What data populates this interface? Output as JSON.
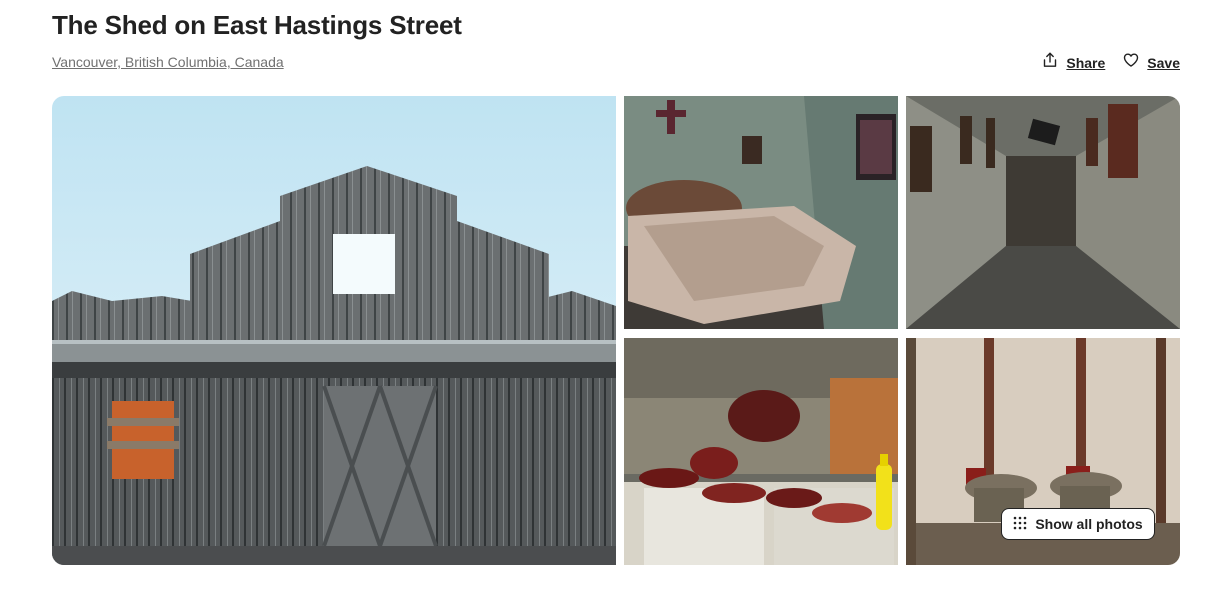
{
  "listing": {
    "title": "The Shed on East Hastings Street",
    "location": "Vancouver, British Columbia, Canada"
  },
  "actions": {
    "share_label": "Share",
    "share_icon": "share-icon",
    "save_label": "Save",
    "save_icon": "heart-icon"
  },
  "gallery": {
    "show_all_label": "Show all photos",
    "show_all_icon": "grid-dots-icon",
    "photos": [
      {
        "subject": "wooden-shed-exterior"
      },
      {
        "subject": "bedroom-with-cross-and-table"
      },
      {
        "subject": "dark-hallway-with-frames"
      },
      {
        "subject": "kitchen-with-gory-props"
      },
      {
        "subject": "bloody-toilets-room"
      }
    ]
  },
  "colors": {
    "text": "#222222",
    "muted": "#717171",
    "button_bg": "#ffffff"
  }
}
